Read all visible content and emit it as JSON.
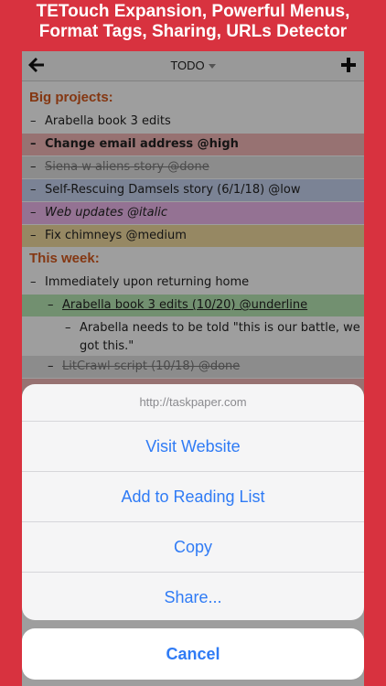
{
  "banner": {
    "line1": "TETouch Expansion, Powerful Menus,",
    "line2": "Format Tags, Sharing, URLs Detector"
  },
  "navbar": {
    "title": "TODO",
    "back_icon": "arrow-left-icon",
    "add_icon": "plus-icon"
  },
  "document": {
    "heading1": "Big projects:",
    "projects": [
      {
        "dash": "–",
        "text": "Arabella book 3 edits"
      },
      {
        "dash": "–",
        "text": "Change email address @high"
      },
      {
        "dash": "–",
        "text": "Siena w aliens story @done"
      },
      {
        "dash": "–",
        "text": "Self-Rescuing Damsels story (6/1/18) @low"
      },
      {
        "dash": "–",
        "text": "Web updates @italic"
      },
      {
        "dash": "–",
        "text": "Fix chimneys @medium"
      }
    ],
    "heading2": "This week:",
    "week": [
      {
        "dash": "–",
        "text": "Immediately upon returning home"
      },
      {
        "dash": "–",
        "text": "Arabella book 3 edits (10/20) @underline"
      },
      {
        "dash": "–",
        "text": "Arabella needs to be told \"this is our battle, we",
        "text2": "got this.\""
      },
      {
        "dash": "–",
        "text": "LitCrawl script (10/18) @done"
      }
    ]
  },
  "action_sheet": {
    "url": "http://taskpaper.com",
    "buttons": [
      "Visit Website",
      "Add to Reading List",
      "Copy",
      "Share..."
    ],
    "cancel": "Cancel"
  },
  "colors": {
    "banner": "#d8323f",
    "heading": "#d65a1e",
    "ios_blue": "#2f7bf5"
  }
}
